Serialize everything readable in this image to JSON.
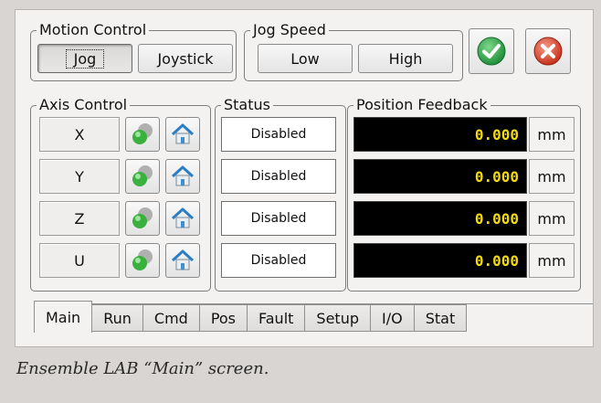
{
  "motion_control": {
    "title": "Motion Control",
    "jog_label": "Jog",
    "joystick_label": "Joystick"
  },
  "jog_speed": {
    "title": "Jog Speed",
    "low_label": "Low",
    "high_label": "High"
  },
  "actions": {
    "ok_icon": "check-icon",
    "cancel_icon": "x-icon",
    "ok_color": "#2fa64a",
    "cancel_color": "#d9402b"
  },
  "axis_control": {
    "title": "Axis Control",
    "axes": [
      {
        "label": "X"
      },
      {
        "label": "Y"
      },
      {
        "label": "Z"
      },
      {
        "label": "U"
      }
    ],
    "enable_icon": "green-ball-icon",
    "home_icon": "home-icon"
  },
  "status": {
    "title": "Status",
    "rows": [
      "Disabled",
      "Disabled",
      "Disabled",
      "Disabled"
    ]
  },
  "position_feedback": {
    "title": "Position Feedback",
    "rows": [
      {
        "value": "0.000",
        "unit": "mm"
      },
      {
        "value": "0.000",
        "unit": "mm"
      },
      {
        "value": "0.000",
        "unit": "mm"
      },
      {
        "value": "0.000",
        "unit": "mm"
      }
    ],
    "value_color": "#f2d90f"
  },
  "tabs": [
    "Main",
    "Run",
    "Cmd",
    "Pos",
    "Fault",
    "Setup",
    "I/O",
    "Stat"
  ],
  "caption": "Ensemble LAB “Main” screen."
}
